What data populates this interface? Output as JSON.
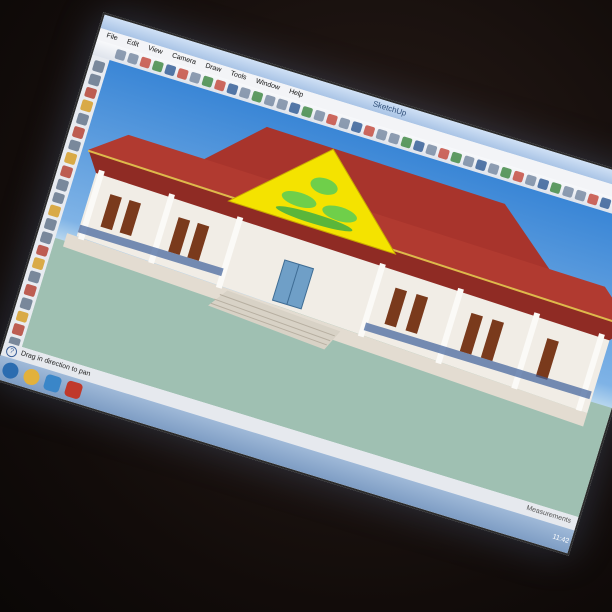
{
  "app": {
    "title": "SketchUp"
  },
  "menubar": {
    "items": [
      "File",
      "Edit",
      "View",
      "Camera",
      "Draw",
      "Tools",
      "Window",
      "Help"
    ]
  },
  "status": {
    "help_icon": "question-icon",
    "message": "Drag in direction to pan",
    "measurements_label": "Measurements"
  },
  "taskbar": {
    "items": [
      {
        "name": "start-orb-icon",
        "color": "#2b6cb0"
      },
      {
        "name": "chrome-icon",
        "color": "#e2b13c"
      },
      {
        "name": "explorer-icon",
        "color": "#3a86c8"
      },
      {
        "name": "sketchup-icon",
        "color": "#c0392b"
      }
    ],
    "time": "11:42"
  },
  "scene": {
    "roof_color": "#a8342c",
    "wall_color": "#f1ede6",
    "gable_color": "#f4e300",
    "ornament_color": "#6fcf4a",
    "window_color": "#7a3a1c",
    "door_color": "#6f9fc7",
    "ground_color": "#9fc0b2",
    "sky_color": "#3a86d6"
  }
}
